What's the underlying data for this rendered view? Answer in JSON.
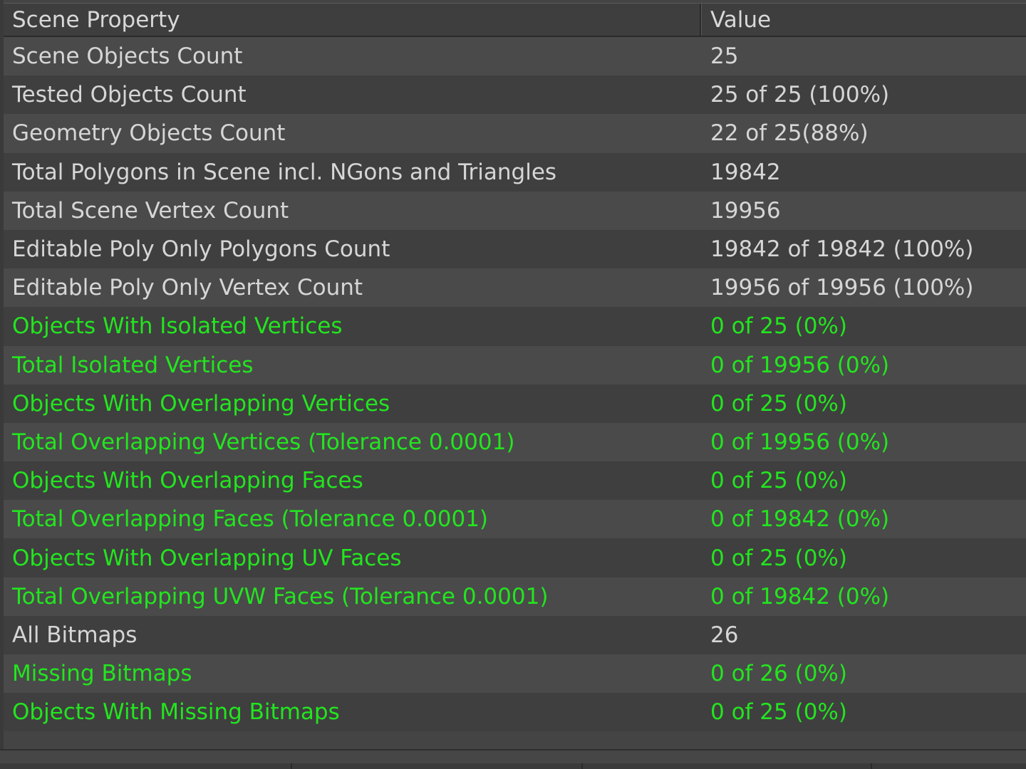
{
  "table": {
    "columns": {
      "property": "Scene Property",
      "value": "Value"
    },
    "rows": [
      {
        "property": "Scene Objects Count",
        "value": "25",
        "status": "normal"
      },
      {
        "property": "Tested Objects Count",
        "value": "25 of 25 (100%)",
        "status": "normal"
      },
      {
        "property": "Geometry Objects Count",
        "value": "22 of 25(88%)",
        "status": "normal"
      },
      {
        "property": "Total Polygons in Scene incl. NGons and Triangles",
        "value": "19842",
        "status": "normal"
      },
      {
        "property": "Total Scene Vertex Count",
        "value": "19956",
        "status": "normal"
      },
      {
        "property": "Editable Poly Only Polygons Count",
        "value": "19842 of 19842 (100%)",
        "status": "normal"
      },
      {
        "property": "Editable Poly Only Vertex Count",
        "value": "19956 of 19956 (100%)",
        "status": "normal"
      },
      {
        "property": "Objects With Isolated Vertices",
        "value": "0 of 25 (0%)",
        "status": "ok"
      },
      {
        "property": "Total Isolated Vertices",
        "value": "0 of 19956 (0%)",
        "status": "ok"
      },
      {
        "property": "Objects With Overlapping Vertices",
        "value": "0 of 25 (0%)",
        "status": "ok"
      },
      {
        "property": "Total Overlapping Vertices (Tolerance 0.0001)",
        "value": "0 of 19956 (0%)",
        "status": "ok"
      },
      {
        "property": "Objects With Overlapping Faces",
        "value": "0 of 25 (0%)",
        "status": "ok"
      },
      {
        "property": "Total Overlapping Faces (Tolerance 0.0001)",
        "value": "0 of 19842 (0%)",
        "status": "ok"
      },
      {
        "property": "Objects With Overlapping UV Faces",
        "value": "0 of 25 (0%)",
        "status": "ok"
      },
      {
        "property": "Total Overlapping UVW Faces (Tolerance 0.0001)",
        "value": "0 of 19842 (0%)",
        "status": "ok"
      },
      {
        "property": "All Bitmaps",
        "value": "26",
        "status": "normal"
      },
      {
        "property": "Missing Bitmaps",
        "value": "0 of 26 (0%)",
        "status": "ok"
      },
      {
        "property": "Objects With Missing Bitmaps",
        "value": "0 of 25 (0%)",
        "status": "ok"
      }
    ]
  },
  "colors": {
    "background": "#444444",
    "normal_text": "#d6d6d6",
    "ok_text": "#23e51f",
    "row_odd": "#4a4a4a",
    "row_even": "#3f3f3f"
  }
}
